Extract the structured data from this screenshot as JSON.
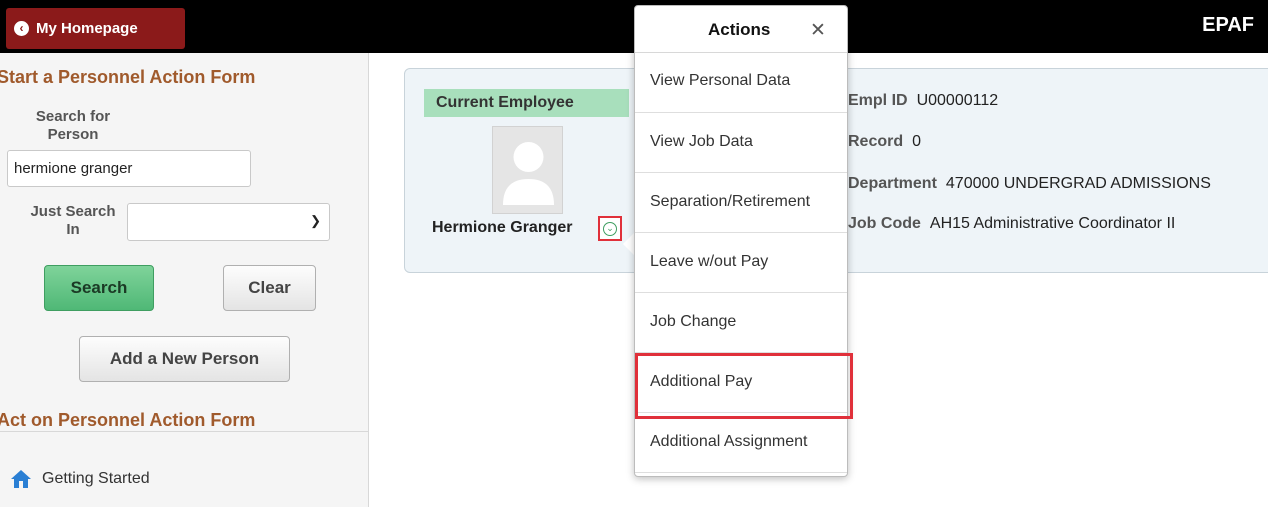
{
  "topbar": {
    "home_label": "My Homepage",
    "app_title": "EPAF"
  },
  "left": {
    "section_start": "Start a Personnel Action Form",
    "search_for_label": "Search for Person",
    "search_value": "hermione granger",
    "just_search_in_label": "Just Search In",
    "select_value": "",
    "search_button": "Search",
    "clear_button": "Clear",
    "add_person_button": "Add a New Person",
    "section_act": "Act on Personnel Action Form",
    "getting_started": "Getting Started"
  },
  "card": {
    "badge": "Current Employee",
    "name": "Hermione Granger",
    "fields": [
      {
        "key": "Empl ID",
        "value": "U00000112"
      },
      {
        "key": "Record",
        "value": "0"
      },
      {
        "key": "Department",
        "value": "470000  UNDERGRAD ADMISSIONS"
      },
      {
        "key": "Job Code",
        "value": "AH15  Administrative Coordinator II"
      }
    ]
  },
  "popup": {
    "title": "Actions",
    "close_icon": "close-icon",
    "items": [
      {
        "label": "View Personal Data"
      },
      {
        "label": "View Job Data"
      },
      {
        "label": "Separation/Retirement"
      },
      {
        "label": "Leave w/out Pay"
      },
      {
        "label": "Job Change"
      },
      {
        "label": "Additional Pay"
      },
      {
        "label": "Additional Assignment"
      }
    ]
  },
  "colors": {
    "accent_red": "#8b1a1a",
    "section_heading": "#a05a2c",
    "search_green": "#4fb876",
    "highlight_red": "#e0303a"
  }
}
